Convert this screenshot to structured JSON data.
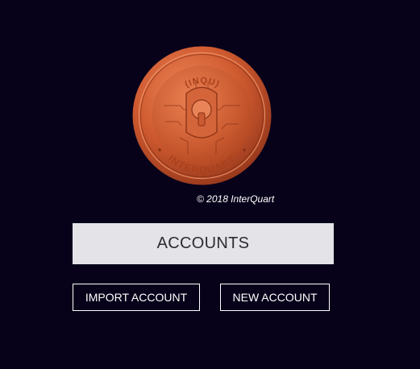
{
  "logo": {
    "top_text": "(INQU)",
    "bottom_text": "INTERQUART",
    "colors": {
      "coin_light": "#e47a4e",
      "coin_mid": "#c9562f",
      "coin_dark": "#8e3416"
    }
  },
  "copyright": "© 2018 InterQuart",
  "accounts_banner": {
    "label": "ACCOUNTS"
  },
  "buttons": {
    "import_label": "IMPORT ACCOUNT",
    "new_label": "NEW ACCOUNT"
  },
  "colors": {
    "background": "#07021a",
    "banner_bg": "#e4e4e8",
    "button_border": "#ffffff"
  }
}
